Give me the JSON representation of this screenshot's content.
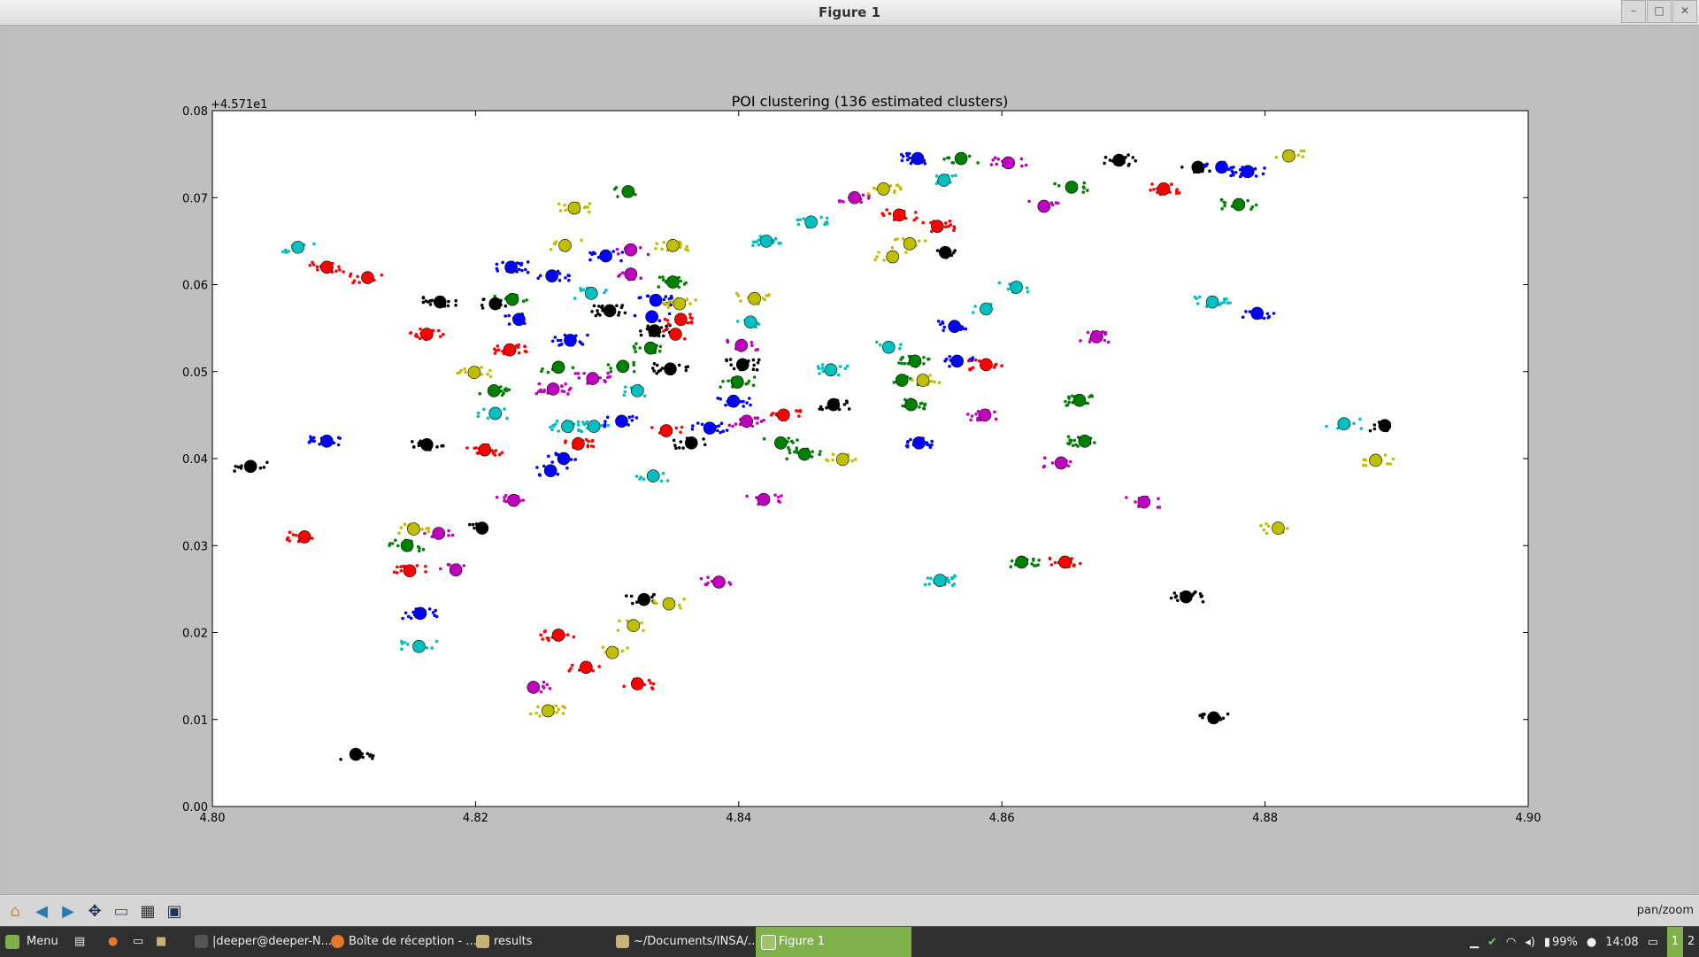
{
  "window": {
    "title": "Figure 1",
    "buttons": [
      "–",
      "□",
      "✕"
    ]
  },
  "chart_data": {
    "type": "scatter",
    "title": "POI clustering (136 estimated clusters)",
    "xlabel": "",
    "ylabel": "",
    "xlim": [
      4.8,
      4.9
    ],
    "ylim": [
      0.0,
      0.08
    ],
    "offset_text": "+4.571e1",
    "x_ticks": [
      "4.80",
      "4.82",
      "4.84",
      "4.86",
      "4.88",
      "4.90"
    ],
    "y_ticks": [
      "0.00",
      "0.01",
      "0.02",
      "0.03",
      "0.04",
      "0.05",
      "0.06",
      "0.07",
      "0.08"
    ],
    "grid": false,
    "color_cycle": [
      "#0000ff",
      "#008000",
      "#ff0000",
      "#00bfbf",
      "#bf00bf",
      "#bfbf00",
      "#000000"
    ],
    "centroids": [
      {
        "x": 4.8029,
        "y": 0.0391,
        "c": "k"
      },
      {
        "x": 4.8065,
        "y": 0.0643,
        "c": "c"
      },
      {
        "x": 4.8087,
        "y": 0.062,
        "c": "r"
      },
      {
        "x": 4.8118,
        "y": 0.0608,
        "c": "r"
      },
      {
        "x": 4.8087,
        "y": 0.042,
        "c": "b"
      },
      {
        "x": 4.807,
        "y": 0.031,
        "c": "r"
      },
      {
        "x": 4.8109,
        "y": 0.006,
        "c": "k"
      },
      {
        "x": 4.8163,
        "y": 0.0543,
        "c": "r"
      },
      {
        "x": 4.8173,
        "y": 0.058,
        "c": "k"
      },
      {
        "x": 4.8163,
        "y": 0.0416,
        "c": "k"
      },
      {
        "x": 4.8153,
        "y": 0.0319,
        "c": "y"
      },
      {
        "x": 4.8148,
        "y": 0.03,
        "c": "g"
      },
      {
        "x": 4.815,
        "y": 0.0271,
        "c": "r"
      },
      {
        "x": 4.8172,
        "y": 0.0314,
        "c": "m"
      },
      {
        "x": 4.8185,
        "y": 0.0272,
        "c": "m"
      },
      {
        "x": 4.8158,
        "y": 0.0222,
        "c": "b"
      },
      {
        "x": 4.8157,
        "y": 0.0184,
        "c": "c"
      },
      {
        "x": 4.8199,
        "y": 0.0499,
        "c": "y"
      },
      {
        "x": 4.8207,
        "y": 0.041,
        "c": "r"
      },
      {
        "x": 4.8205,
        "y": 0.032,
        "c": "k"
      },
      {
        "x": 4.8215,
        "y": 0.0578,
        "c": "k"
      },
      {
        "x": 4.8227,
        "y": 0.062,
        "c": "b"
      },
      {
        "x": 4.8228,
        "y": 0.0583,
        "c": "g"
      },
      {
        "x": 4.8233,
        "y": 0.056,
        "c": "b"
      },
      {
        "x": 4.8226,
        "y": 0.0525,
        "c": "r"
      },
      {
        "x": 4.8214,
        "y": 0.0478,
        "c": "g"
      },
      {
        "x": 4.8215,
        "y": 0.0452,
        "c": "c"
      },
      {
        "x": 4.8229,
        "y": 0.0352,
        "c": "m"
      },
      {
        "x": 4.8258,
        "y": 0.061,
        "c": "b"
      },
      {
        "x": 4.8268,
        "y": 0.0645,
        "c": "y"
      },
      {
        "x": 4.8275,
        "y": 0.0688,
        "c": "y"
      },
      {
        "x": 4.8272,
        "y": 0.0536,
        "c": "b"
      },
      {
        "x": 4.8263,
        "y": 0.0505,
        "c": "g"
      },
      {
        "x": 4.8259,
        "y": 0.048,
        "c": "m"
      },
      {
        "x": 4.827,
        "y": 0.0437,
        "c": "c"
      },
      {
        "x": 4.8278,
        "y": 0.0417,
        "c": "r"
      },
      {
        "x": 4.8267,
        "y": 0.04,
        "c": "b"
      },
      {
        "x": 4.8257,
        "y": 0.0386,
        "c": "b"
      },
      {
        "x": 4.8263,
        "y": 0.0197,
        "c": "r"
      },
      {
        "x": 4.8244,
        "y": 0.0137,
        "c": "m"
      },
      {
        "x": 4.8255,
        "y": 0.011,
        "c": "y"
      },
      {
        "x": 4.8284,
        "y": 0.016,
        "c": "r"
      },
      {
        "x": 4.8288,
        "y": 0.059,
        "c": "c"
      },
      {
        "x": 4.8299,
        "y": 0.0633,
        "c": "b"
      },
      {
        "x": 4.8302,
        "y": 0.057,
        "c": "k"
      },
      {
        "x": 4.8289,
        "y": 0.0492,
        "c": "m"
      },
      {
        "x": 4.829,
        "y": 0.0437,
        "c": "c"
      },
      {
        "x": 4.8312,
        "y": 0.0506,
        "c": "g"
      },
      {
        "x": 4.8316,
        "y": 0.0707,
        "c": "g"
      },
      {
        "x": 4.8318,
        "y": 0.064,
        "c": "m"
      },
      {
        "x": 4.8318,
        "y": 0.0612,
        "c": "m"
      },
      {
        "x": 4.8323,
        "y": 0.0478,
        "c": "c"
      },
      {
        "x": 4.8311,
        "y": 0.0443,
        "c": "b"
      },
      {
        "x": 4.8304,
        "y": 0.0177,
        "c": "y"
      },
      {
        "x": 4.832,
        "y": 0.0208,
        "c": "y"
      },
      {
        "x": 4.8323,
        "y": 0.0141,
        "c": "r"
      },
      {
        "x": 4.8328,
        "y": 0.0238,
        "c": "k"
      },
      {
        "x": 4.8335,
        "y": 0.038,
        "c": "c"
      },
      {
        "x": 4.8333,
        "y": 0.0527,
        "c": "g"
      },
      {
        "x": 4.8334,
        "y": 0.0563,
        "c": "b"
      },
      {
        "x": 4.8337,
        "y": 0.0582,
        "c": "b"
      },
      {
        "x": 4.8336,
        "y": 0.0547,
        "c": "k"
      },
      {
        "x": 4.8345,
        "y": 0.0432,
        "c": "r"
      },
      {
        "x": 4.8347,
        "y": 0.0233,
        "c": "y"
      },
      {
        "x": 4.835,
        "y": 0.0645,
        "c": "y"
      },
      {
        "x": 4.835,
        "y": 0.0603,
        "c": "g"
      },
      {
        "x": 4.8355,
        "y": 0.0578,
        "c": "y"
      },
      {
        "x": 4.8356,
        "y": 0.056,
        "c": "r"
      },
      {
        "x": 4.8352,
        "y": 0.0543,
        "c": "r"
      },
      {
        "x": 4.8348,
        "y": 0.0503,
        "c": "k"
      },
      {
        "x": 4.8364,
        "y": 0.0418,
        "c": "k"
      },
      {
        "x": 4.8378,
        "y": 0.0435,
        "c": "b"
      },
      {
        "x": 4.8385,
        "y": 0.0258,
        "c": "m"
      },
      {
        "x": 4.8396,
        "y": 0.0466,
        "c": "b"
      },
      {
        "x": 4.8399,
        "y": 0.0488,
        "c": "g"
      },
      {
        "x": 4.8403,
        "y": 0.0508,
        "c": "k"
      },
      {
        "x": 4.8402,
        "y": 0.053,
        "c": "m"
      },
      {
        "x": 4.8409,
        "y": 0.0557,
        "c": "c"
      },
      {
        "x": 4.8412,
        "y": 0.0584,
        "c": "y"
      },
      {
        "x": 4.8406,
        "y": 0.0443,
        "c": "m"
      },
      {
        "x": 4.8419,
        "y": 0.0353,
        "c": "m"
      },
      {
        "x": 4.8421,
        "y": 0.065,
        "c": "c"
      },
      {
        "x": 4.8434,
        "y": 0.045,
        "c": "r"
      },
      {
        "x": 4.8432,
        "y": 0.0418,
        "c": "g"
      },
      {
        "x": 4.845,
        "y": 0.0405,
        "c": "g"
      },
      {
        "x": 4.8455,
        "y": 0.0672,
        "c": "c"
      },
      {
        "x": 4.847,
        "y": 0.0502,
        "c": "c"
      },
      {
        "x": 4.8472,
        "y": 0.0462,
        "c": "k"
      },
      {
        "x": 4.8479,
        "y": 0.0399,
        "c": "y"
      },
      {
        "x": 4.8488,
        "y": 0.07,
        "c": "m"
      },
      {
        "x": 4.851,
        "y": 0.071,
        "c": "y"
      },
      {
        "x": 4.8514,
        "y": 0.0528,
        "c": "c"
      },
      {
        "x": 4.8517,
        "y": 0.0632,
        "c": "y"
      },
      {
        "x": 4.8522,
        "y": 0.068,
        "c": "r"
      },
      {
        "x": 4.8524,
        "y": 0.049,
        "c": "g"
      },
      {
        "x": 4.853,
        "y": 0.0647,
        "c": "y"
      },
      {
        "x": 4.8531,
        "y": 0.0462,
        "c": "g"
      },
      {
        "x": 4.8534,
        "y": 0.0512,
        "c": "g"
      },
      {
        "x": 4.8536,
        "y": 0.0745,
        "c": "b"
      },
      {
        "x": 4.8537,
        "y": 0.0418,
        "c": "b"
      },
      {
        "x": 4.854,
        "y": 0.049,
        "c": "y"
      },
      {
        "x": 4.8553,
        "y": 0.026,
        "c": "c"
      },
      {
        "x": 4.8551,
        "y": 0.0667,
        "c": "r"
      },
      {
        "x": 4.8556,
        "y": 0.072,
        "c": "c"
      },
      {
        "x": 4.8557,
        "y": 0.0637,
        "c": "k"
      },
      {
        "x": 4.8569,
        "y": 0.0745,
        "c": "g"
      },
      {
        "x": 4.8564,
        "y": 0.0552,
        "c": "b"
      },
      {
        "x": 4.8566,
        "y": 0.0512,
        "c": "b"
      },
      {
        "x": 4.8588,
        "y": 0.0572,
        "c": "c"
      },
      {
        "x": 4.8588,
        "y": 0.0508,
        "c": "r"
      },
      {
        "x": 4.8587,
        "y": 0.045,
        "c": "m"
      },
      {
        "x": 4.8605,
        "y": 0.074,
        "c": "m"
      },
      {
        "x": 4.8611,
        "y": 0.0597,
        "c": "c"
      },
      {
        "x": 4.8615,
        "y": 0.0281,
        "c": "g"
      },
      {
        "x": 4.8632,
        "y": 0.069,
        "c": "m"
      },
      {
        "x": 4.8645,
        "y": 0.0395,
        "c": "m"
      },
      {
        "x": 4.8648,
        "y": 0.0281,
        "c": "r"
      },
      {
        "x": 4.8653,
        "y": 0.0712,
        "c": "g"
      },
      {
        "x": 4.8659,
        "y": 0.0467,
        "c": "g"
      },
      {
        "x": 4.8663,
        "y": 0.042,
        "c": "g"
      },
      {
        "x": 4.8672,
        "y": 0.054,
        "c": "m"
      },
      {
        "x": 4.8689,
        "y": 0.0743,
        "c": "k"
      },
      {
        "x": 4.8708,
        "y": 0.035,
        "c": "m"
      },
      {
        "x": 4.8723,
        "y": 0.071,
        "c": "r"
      },
      {
        "x": 4.874,
        "y": 0.0241,
        "c": "k"
      },
      {
        "x": 4.8749,
        "y": 0.0735,
        "c": "k"
      },
      {
        "x": 4.876,
        "y": 0.058,
        "c": "c"
      },
      {
        "x": 4.8761,
        "y": 0.0102,
        "c": "k"
      },
      {
        "x": 4.8767,
        "y": 0.0735,
        "c": "b"
      },
      {
        "x": 4.878,
        "y": 0.0692,
        "c": "g"
      },
      {
        "x": 4.8787,
        "y": 0.073,
        "c": "b"
      },
      {
        "x": 4.8794,
        "y": 0.0567,
        "c": "b"
      },
      {
        "x": 4.881,
        "y": 0.032,
        "c": "y"
      },
      {
        "x": 4.8818,
        "y": 0.0748,
        "c": "y"
      },
      {
        "x": 4.886,
        "y": 0.044,
        "c": "c"
      },
      {
        "x": 4.8884,
        "y": 0.0398,
        "c": "y"
      },
      {
        "x": 4.8891,
        "y": 0.0438,
        "c": "k"
      }
    ]
  },
  "toolbar": {
    "buttons": [
      "home-icon",
      "back-icon",
      "forward-icon",
      "pan-icon",
      "zoom-icon",
      "subplots-icon",
      "save-icon"
    ],
    "mode": "pan/zoom"
  },
  "taskbar": {
    "menu": "Menu",
    "tasks": [
      {
        "label": "|deeper@deeper-N...",
        "color": "#555555"
      },
      {
        "label": "Boîte de réception - ...",
        "color": "#e8772e"
      },
      {
        "label": "results",
        "color": "#c9b27a"
      },
      {
        "label": "~/Documents/INSA/...",
        "color": "#c9b27a"
      },
      {
        "label": "Figure 1",
        "color": "#9fc46a"
      }
    ],
    "battery": "99%",
    "clock": "14:08",
    "workspaces": [
      "1",
      "2"
    ]
  }
}
